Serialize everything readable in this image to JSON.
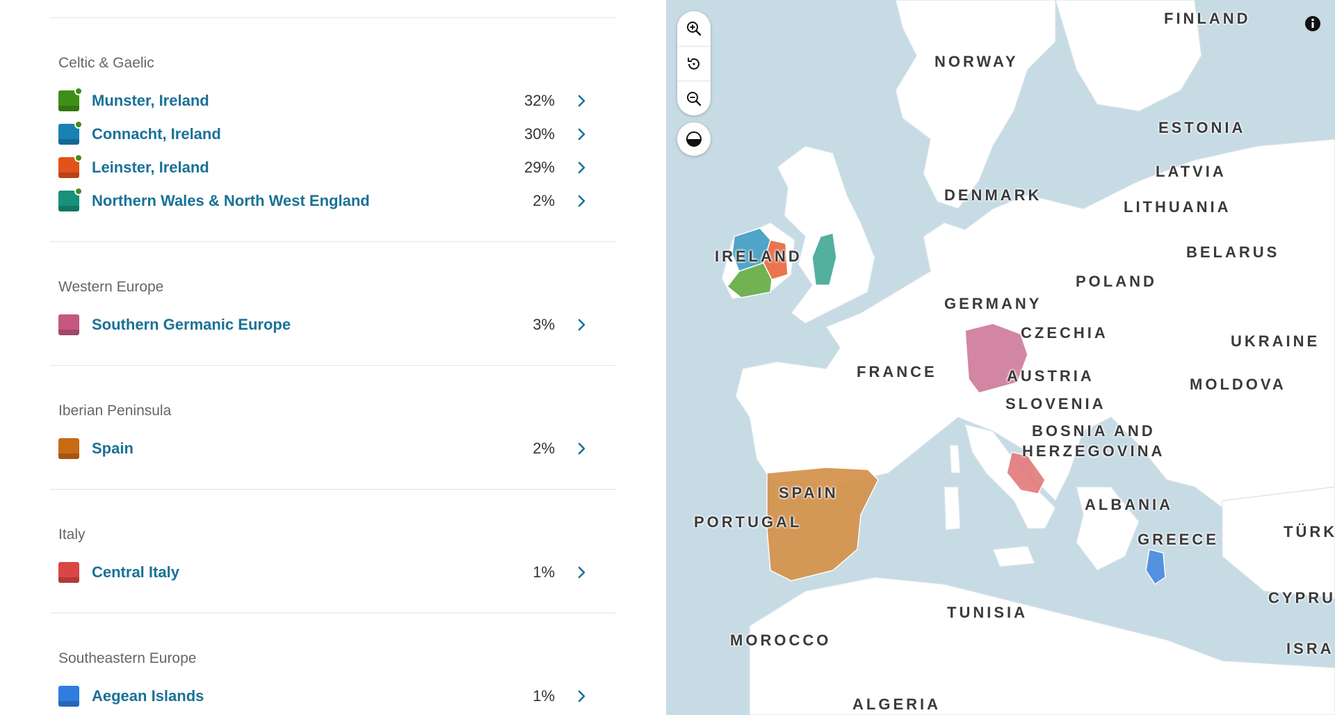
{
  "groups": [
    {
      "title": "Celtic & Gaelic",
      "items": [
        {
          "name": "Munster, Ireland",
          "pct": "32%",
          "color": "#3f8f17",
          "new": true
        },
        {
          "name": "Connacht, Ireland",
          "pct": "30%",
          "color": "#1980b2",
          "new": true
        },
        {
          "name": "Leinster, Ireland",
          "pct": "29%",
          "color": "#e4521b",
          "new": true
        },
        {
          "name": "Northern Wales & North West England",
          "pct": "2%",
          "color": "#17917a",
          "new": true
        }
      ]
    },
    {
      "title": "Western Europe",
      "items": [
        {
          "name": "Southern Germanic Europe",
          "pct": "3%",
          "color": "#c4587f",
          "new": false
        }
      ]
    },
    {
      "title": "Iberian Peninsula",
      "items": [
        {
          "name": "Spain",
          "pct": "2%",
          "color": "#c96a14",
          "new": false
        }
      ]
    },
    {
      "title": "Italy",
      "items": [
        {
          "name": "Central Italy",
          "pct": "1%",
          "color": "#d94646",
          "new": false
        }
      ]
    },
    {
      "title": "Southeastern Europe",
      "items": [
        {
          "name": "Aegean Islands",
          "pct": "1%",
          "color": "#2f7de0",
          "new": false
        }
      ]
    }
  ],
  "map": {
    "labels": [
      "FINLAND",
      "NORWAY",
      "ESTONIA",
      "LATVIA",
      "DENMARK",
      "LITHUANIA",
      "BELARUS",
      "IRELAND",
      "POLAND",
      "GERMANY",
      "CZECHIA",
      "UKRAINE",
      "FRANCE",
      "AUSTRIA",
      "MOLDOVA",
      "SLOVENIA",
      "BOSNIA AND",
      "HERZEGOVINA",
      "SPAIN",
      "PORTUGAL",
      "ALBANIA",
      "GREECE",
      "TÜRK",
      "CYPRU",
      "TUNISIA",
      "MOROCCO",
      "ISRA",
      "ALGERIA"
    ],
    "colors": {
      "sea": "#c7dbe4",
      "land": "#ffffff",
      "border": "#d5e2ea",
      "label": "#3a3a3a"
    }
  },
  "controls": {
    "zoom_in_icon": "zoom-in-icon",
    "reset_icon": "reset-icon",
    "zoom_out_icon": "zoom-out-icon",
    "contrast_icon": "contrast-icon",
    "info_icon": "info-icon"
  },
  "colors": {
    "link": "#1a7196",
    "new_dot": "#3f8f17",
    "group_title": "#666666"
  }
}
